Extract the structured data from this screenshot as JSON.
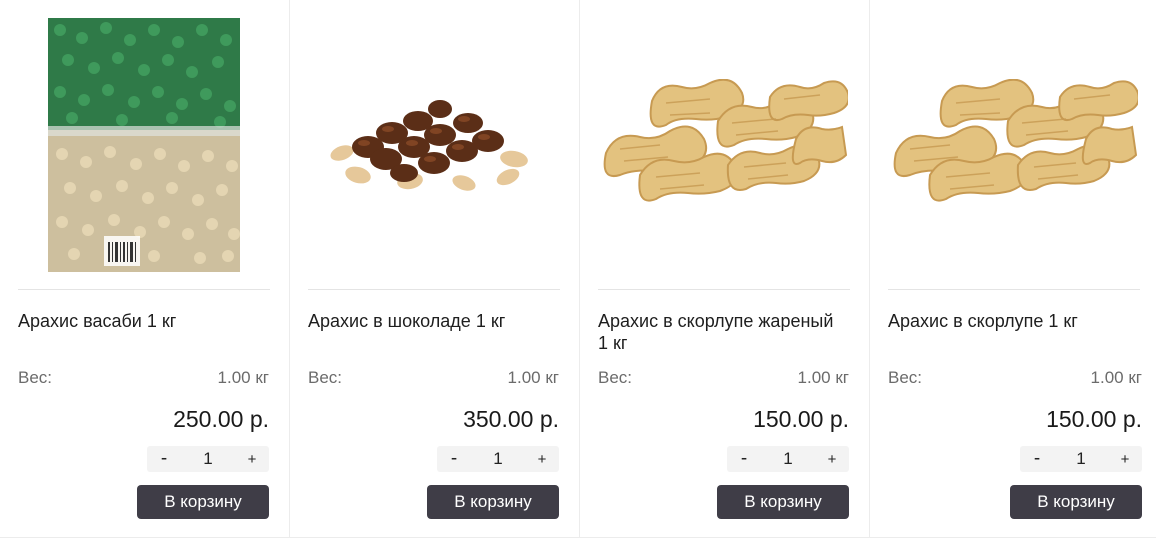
{
  "products": [
    {
      "title": "Арахис васаби 1 кг",
      "image_icon": "wasabi-peanuts-bag-image",
      "weight_label": "Вес:",
      "weight_value": "1.00 кг",
      "price": "250.00 р.",
      "quantity": "1",
      "minus_label": "-",
      "plus_label": "+",
      "cart_label": "В корзину"
    },
    {
      "title": "Арахис в шоколаде 1 кг",
      "image_icon": "chocolate-peanuts-image",
      "weight_label": "Вес:",
      "weight_value": "1.00 кг",
      "price": "350.00 р.",
      "quantity": "1",
      "minus_label": "-",
      "plus_label": "+",
      "cart_label": "В корзину"
    },
    {
      "title": "Арахис в скорлупе жареный 1 кг",
      "image_icon": "peanuts-in-shell-image",
      "weight_label": "Вес:",
      "weight_value": "1.00 кг",
      "price": "150.00 р.",
      "quantity": "1",
      "minus_label": "-",
      "plus_label": "+",
      "cart_label": "В корзину"
    },
    {
      "title": "Арахис в скорлупе 1 кг",
      "image_icon": "peanuts-in-shell-image",
      "weight_label": "Вес:",
      "weight_value": "1.00 кг",
      "price": "150.00 р.",
      "quantity": "1",
      "minus_label": "-",
      "plus_label": "+",
      "cart_label": "В корзину"
    }
  ],
  "colors": {
    "cart_button": "#3f3d47",
    "qty_background": "#f3f3f3",
    "divider": "#ececec"
  }
}
